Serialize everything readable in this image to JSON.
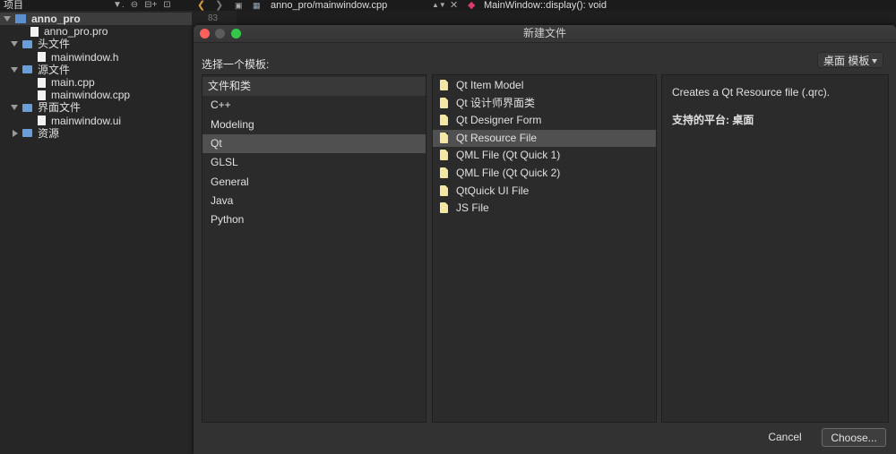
{
  "left_pane": {
    "header": "项目",
    "tools": [
      "▼.",
      "⊖",
      "⊟+",
      "⊡"
    ],
    "tree": [
      {
        "label": "anno_pro",
        "icon": "project-icon",
        "arrow": "down",
        "indent": 0,
        "selected": true
      },
      {
        "label": "anno_pro.pro",
        "icon": "pro-file-icon",
        "arrow": "",
        "indent": 2,
        "selected": false
      },
      {
        "label": "头文件",
        "icon": "folder-icon",
        "arrow": "down",
        "indent": 1,
        "selected": false
      },
      {
        "label": "mainwindow.h",
        "icon": "header-file-icon",
        "arrow": "",
        "indent": 3,
        "selected": false
      },
      {
        "label": "源文件",
        "icon": "folder-icon",
        "arrow": "down",
        "indent": 1,
        "selected": false
      },
      {
        "label": "main.cpp",
        "icon": "cpp-file-icon",
        "arrow": "",
        "indent": 3,
        "selected": false
      },
      {
        "label": "mainwindow.cpp",
        "icon": "cpp-file-icon",
        "arrow": "",
        "indent": 3,
        "selected": false
      },
      {
        "label": "界面文件",
        "icon": "folder-icon",
        "arrow": "down",
        "indent": 1,
        "selected": false
      },
      {
        "label": "mainwindow.ui",
        "icon": "ui-file-icon",
        "arrow": "",
        "indent": 3,
        "selected": false
      },
      {
        "label": "资源",
        "icon": "folder-icon",
        "arrow": "right",
        "indent": 1,
        "selected": false
      }
    ]
  },
  "editor": {
    "file_path": "anno_pro/mainwindow.cpp",
    "function": "MainWindow::display(): void",
    "line_number": "83"
  },
  "dialog": {
    "title": "新建文件",
    "choose_template_label": "选择一个模板:",
    "filter_value": "桌面 模板",
    "categories": [
      {
        "label": "文件和类",
        "header": true,
        "selected": false
      },
      {
        "label": "C++",
        "header": false,
        "selected": false
      },
      {
        "label": "Modeling",
        "header": false,
        "selected": false
      },
      {
        "label": "Qt",
        "header": false,
        "selected": true
      },
      {
        "label": "GLSL",
        "header": false,
        "selected": false
      },
      {
        "label": "General",
        "header": false,
        "selected": false
      },
      {
        "label": "Java",
        "header": false,
        "selected": false
      },
      {
        "label": "Python",
        "header": false,
        "selected": false
      }
    ],
    "templates": [
      {
        "label": "Qt Item Model",
        "selected": false
      },
      {
        "label": "Qt 设计师界面类",
        "selected": false
      },
      {
        "label": "Qt Designer Form",
        "selected": false
      },
      {
        "label": "Qt Resource File",
        "selected": true
      },
      {
        "label": "QML File (Qt Quick 1)",
        "selected": false
      },
      {
        "label": "QML File (Qt Quick 2)",
        "selected": false
      },
      {
        "label": "QtQuick UI File",
        "selected": false
      },
      {
        "label": "JS File",
        "selected": false
      }
    ],
    "description": "Creates a Qt Resource file (.qrc).",
    "platform_label": "支持的平台:",
    "platform_value": "桌面",
    "cancel_label": "Cancel",
    "choose_label": "Choose..."
  },
  "colors": {
    "close": "#fc605c",
    "minimize": "#5c5c5c",
    "zoom": "#34c84a",
    "selection": "#505050"
  }
}
